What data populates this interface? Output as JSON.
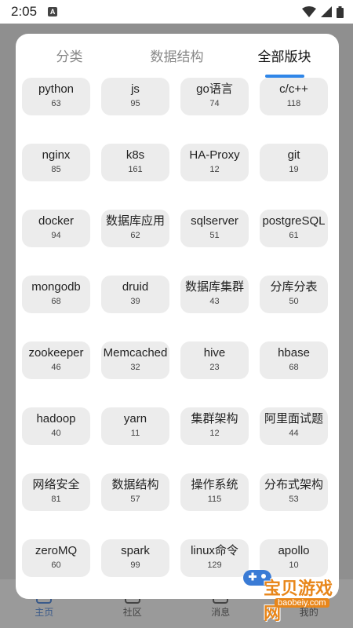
{
  "status_bar": {
    "time": "2:05",
    "notification_letter": "A"
  },
  "background": {
    "bottom_nav": [
      {
        "label": "主页",
        "active": true
      },
      {
        "label": "社区",
        "active": false
      },
      {
        "label": "消息",
        "active": false
      },
      {
        "label": "我的",
        "active": false
      }
    ]
  },
  "tabs": [
    {
      "label": "分类",
      "active": false
    },
    {
      "label": "数据结构",
      "active": false
    },
    {
      "label": "全部版块",
      "active": true
    }
  ],
  "accent_color": "#2f86e8",
  "forums": [
    {
      "name": "python",
      "count": "63"
    },
    {
      "name": "js",
      "count": "95"
    },
    {
      "name": "go语言",
      "count": "74"
    },
    {
      "name": "c/c++",
      "count": "118"
    },
    {
      "name": "nginx",
      "count": "85"
    },
    {
      "name": "k8s",
      "count": "161"
    },
    {
      "name": "HA-Proxy",
      "count": "12"
    },
    {
      "name": "git",
      "count": "19"
    },
    {
      "name": "docker",
      "count": "94"
    },
    {
      "name": "数据库应用",
      "count": "62"
    },
    {
      "name": "sqlserver",
      "count": "51"
    },
    {
      "name": "postgreSQL",
      "count": "61"
    },
    {
      "name": "mongodb",
      "count": "68"
    },
    {
      "name": "druid",
      "count": "39"
    },
    {
      "name": "数据库集群",
      "count": "43"
    },
    {
      "name": "分库分表",
      "count": "50"
    },
    {
      "name": "zookeeper",
      "count": "46"
    },
    {
      "name": "Memcached",
      "count": "32"
    },
    {
      "name": "hive",
      "count": "23"
    },
    {
      "name": "hbase",
      "count": "68"
    },
    {
      "name": "hadoop",
      "count": "40"
    },
    {
      "name": "yarn",
      "count": "11"
    },
    {
      "name": "集群架构",
      "count": "12"
    },
    {
      "name": "阿里面试题",
      "count": "44"
    },
    {
      "name": "网络安全",
      "count": "81"
    },
    {
      "name": "数据结构",
      "count": "57"
    },
    {
      "name": "操作系统",
      "count": "115"
    },
    {
      "name": "分布式架构",
      "count": "53"
    },
    {
      "name": "zeroMQ",
      "count": "60"
    },
    {
      "name": "spark",
      "count": "99"
    },
    {
      "name": "linux命令",
      "count": "129"
    },
    {
      "name": "apollo",
      "count": "10"
    }
  ],
  "watermark": {
    "text": "宝贝游戏网",
    "url": "baobeiy.com"
  }
}
